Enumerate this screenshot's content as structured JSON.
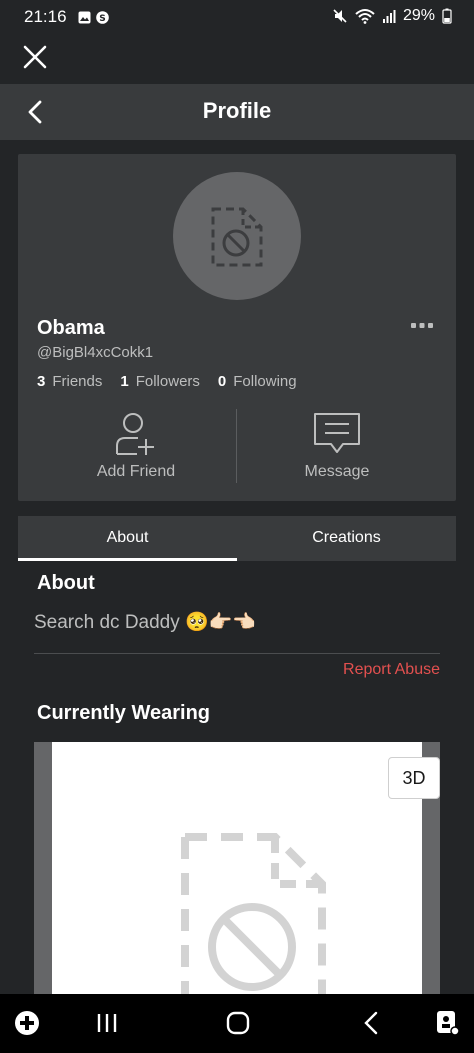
{
  "status_bar": {
    "time": "21:16",
    "battery": "29%"
  },
  "header": {
    "title": "Profile"
  },
  "profile": {
    "display_name": "Obama",
    "username": "@BigBl4xcCokk1",
    "stats": [
      {
        "count": "3",
        "label": "Friends"
      },
      {
        "count": "1",
        "label": "Followers"
      },
      {
        "count": "0",
        "label": "Following"
      }
    ],
    "actions": {
      "add_friend": "Add Friend",
      "message": "Message"
    }
  },
  "tabs": [
    {
      "label": "About",
      "active": true
    },
    {
      "label": "Creations",
      "active": false
    }
  ],
  "about": {
    "title": "About",
    "text": "Search dc  Daddy 🥺👉🏻👈🏻",
    "report_label": "Report Abuse"
  },
  "wearing": {
    "title": "Currently Wearing",
    "view_3d_label": "3D"
  },
  "colors": {
    "background": "#232527",
    "card": "#393b3d",
    "report": "#e2504f"
  }
}
